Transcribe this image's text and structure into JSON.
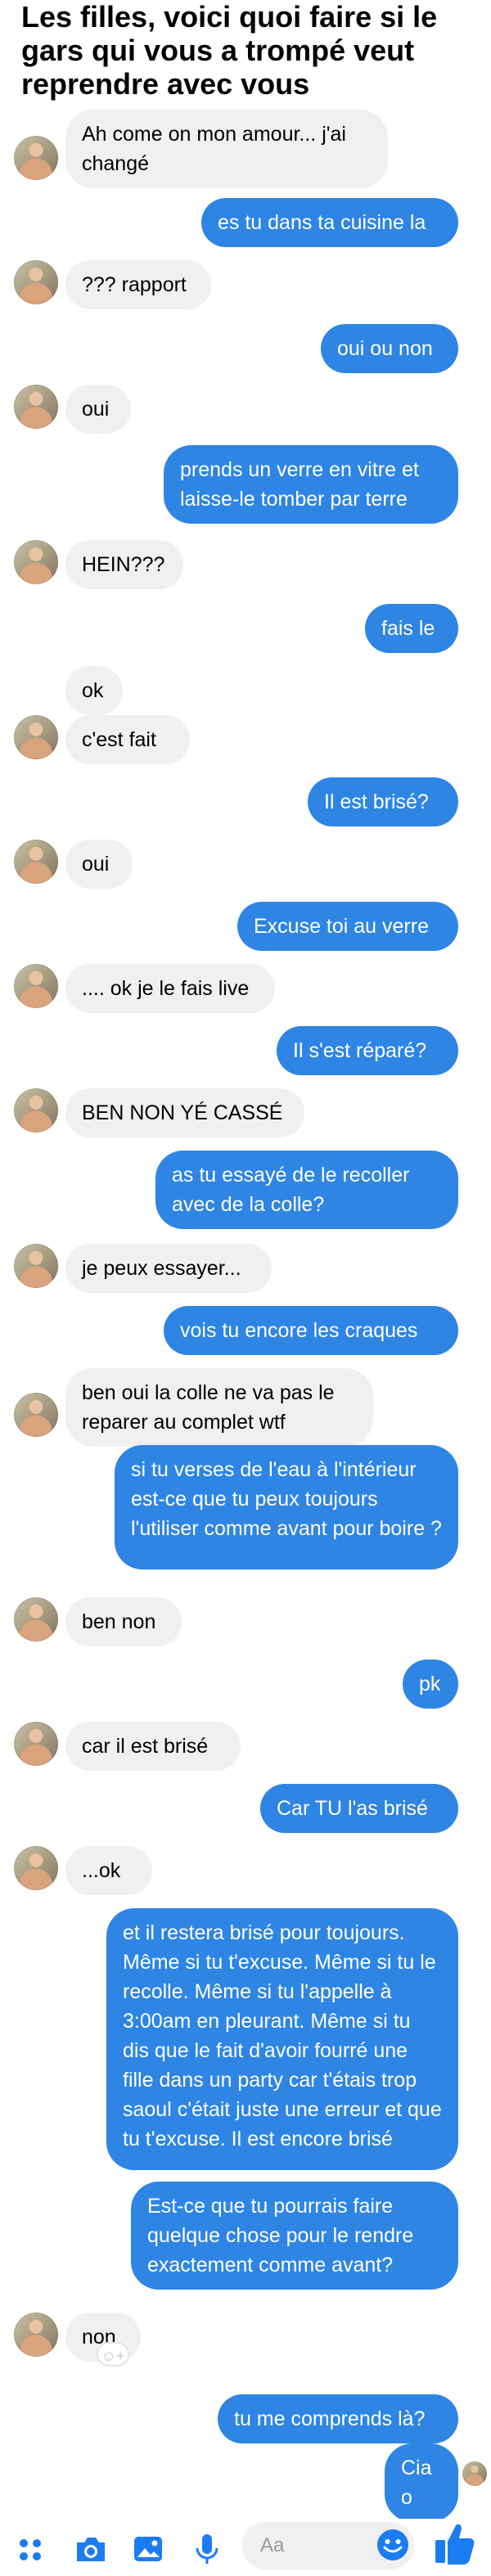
{
  "caption": "Les filles, voici quoi faire si le gars qui vous a trompé veut reprendre avec vous",
  "messages": [
    {
      "from": "them",
      "text": "Ah come on mon amour... j'ai changé"
    },
    {
      "from": "me",
      "text": "es tu dans ta cuisine la"
    },
    {
      "from": "them",
      "text": "??? rapport"
    },
    {
      "from": "me",
      "text": "oui ou non"
    },
    {
      "from": "them",
      "text": "oui"
    },
    {
      "from": "me",
      "text": "prends un verre en vitre et laisse-le tomber par terre"
    },
    {
      "from": "them",
      "text": "HEIN???"
    },
    {
      "from": "me",
      "text": "fais le"
    },
    {
      "from": "them",
      "text": "ok"
    },
    {
      "from": "them",
      "text": "c'est fait"
    },
    {
      "from": "me",
      "text": "Il est brisé?"
    },
    {
      "from": "them",
      "text": "oui"
    },
    {
      "from": "me",
      "text": "Excuse toi au verre"
    },
    {
      "from": "them",
      "text": ".... ok je le fais live"
    },
    {
      "from": "me",
      "text": "Il s'est réparé?"
    },
    {
      "from": "them",
      "text": "BEN NON YÉ CASSÉ"
    },
    {
      "from": "me",
      "text": "as tu essayé de le recoller avec de la colle?"
    },
    {
      "from": "them",
      "text": "je peux essayer..."
    },
    {
      "from": "me",
      "text": "vois tu encore les craques"
    },
    {
      "from": "them",
      "text": "ben oui la colle ne va pas le reparer au complet wtf"
    },
    {
      "from": "me",
      "text": "si tu verses de l'eau à l'intérieur est-ce que tu peux toujours l'utiliser comme avant pour boire ?"
    },
    {
      "from": "them",
      "text": "ben non"
    },
    {
      "from": "me",
      "text": "pk"
    },
    {
      "from": "them",
      "text": "car il est brisé"
    },
    {
      "from": "me",
      "text": "Car TU l'as brisé"
    },
    {
      "from": "them",
      "text": "...ok"
    },
    {
      "from": "me",
      "text": "et il restera brisé pour toujours. Même si tu t'excuse. Même si tu le recolle. Même si tu l'appelle à 3:00am en pleurant. Même si tu dis que le fait d'avoir fourré une fille dans un party car t'étais trop saoul c'était juste une erreur et que tu t'excuse. Il est encore brisé"
    },
    {
      "from": "me",
      "text": "Est-ce que tu pourrais faire quelque chose pour le rendre exactement comme avant?"
    },
    {
      "from": "them",
      "text": "non"
    },
    {
      "from": "me",
      "text": "tu me comprends là?"
    },
    {
      "from": "me",
      "text": "Ciao"
    }
  ],
  "composer": {
    "placeholder": "Aa"
  },
  "icons": [
    "apps-icon",
    "camera-icon",
    "gallery-icon",
    "microphone-icon",
    "emoji-icon",
    "thumbs-up-icon",
    "add-reaction-icon"
  ],
  "colors": {
    "outgoing": "#2e85e4",
    "incoming": "#f0f0f0",
    "accent": "#1b7cf2"
  }
}
